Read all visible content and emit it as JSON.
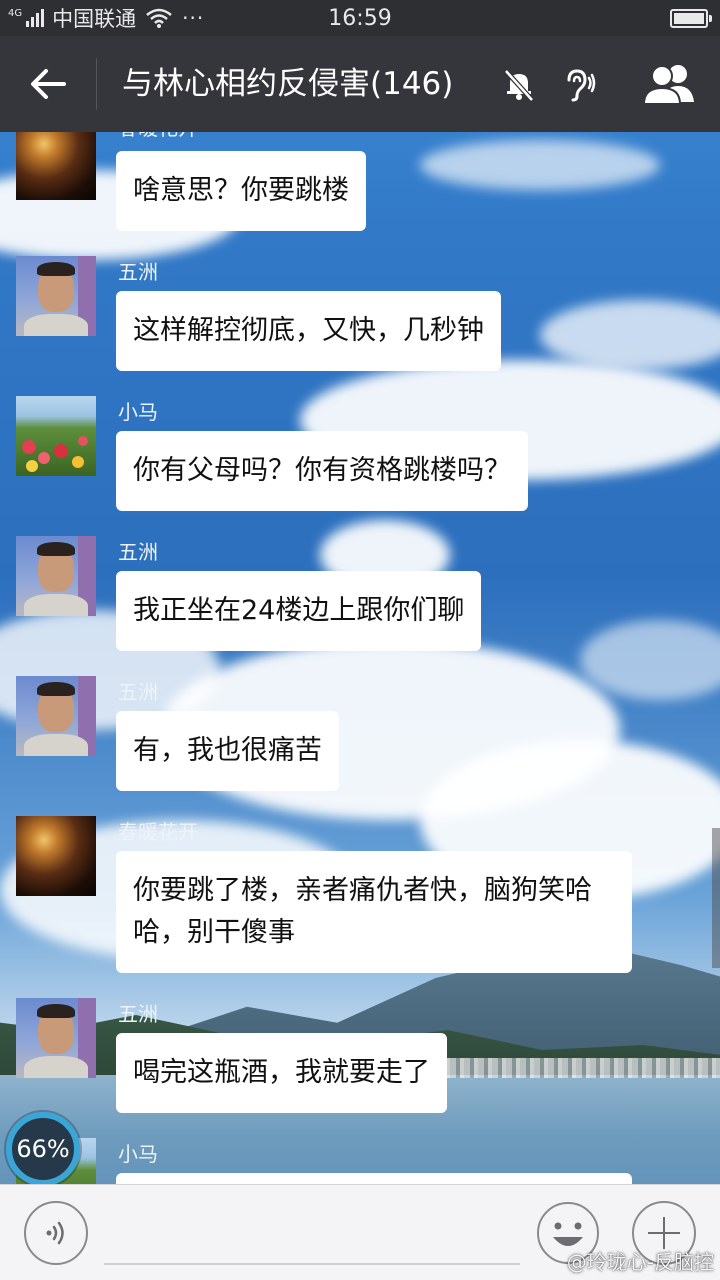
{
  "status_bar": {
    "network_type": "4G",
    "carrier": "中国联通",
    "more": "···",
    "time": "16:59",
    "battery_level": 1.0
  },
  "title_bar": {
    "title": "与林心相约反侵害(146)",
    "icons": [
      "back-arrow-icon",
      "mute-bell-icon",
      "ear-icon",
      "members-icon"
    ]
  },
  "messages": [
    {
      "sender": "春暖花开",
      "avatar": "sunset",
      "text": "啥意思？你要跳楼"
    },
    {
      "sender": "五洲",
      "avatar": "man",
      "text": "这样解控彻底，又快，几秒钟"
    },
    {
      "sender": "小马",
      "avatar": "flowers",
      "text": "你有父母吗？你有资格跳楼吗？"
    },
    {
      "sender": "五洲",
      "avatar": "man",
      "text": "我正坐在24楼边上跟你们聊"
    },
    {
      "sender": "五洲",
      "avatar": "man",
      "text": "有，我也很痛苦"
    },
    {
      "sender": "春暖花开",
      "avatar": "sunset",
      "text": "你要跳了楼，亲者痛仇者快，脑狗笑哈哈，别干傻事"
    },
    {
      "sender": "五洲",
      "avatar": "man",
      "text": "喝完这瓶酒，我就要走了"
    },
    {
      "sender": "小马",
      "avatar": "flowers",
      "text": ""
    }
  ],
  "overlay": {
    "speed_badge": "66%"
  },
  "input_bar": {
    "icons": [
      "voice-icon",
      "emoji-icon",
      "plus-icon"
    ]
  },
  "watermark": "@玲珑心-反脑控",
  "colors": {
    "status_bar": "#2e2f33",
    "title_bar": "#35363b",
    "bubble": "#ffffff",
    "input_bar": "#f4f4f6"
  }
}
